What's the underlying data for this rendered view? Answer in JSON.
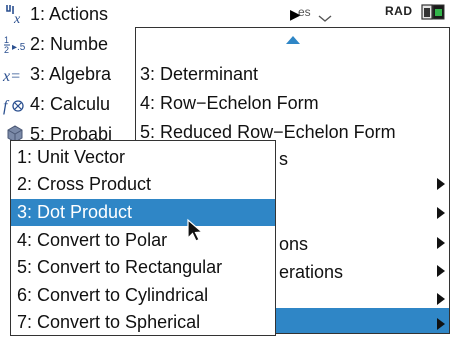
{
  "colors": {
    "accent": "#2f86c6",
    "border": "#333333",
    "icon": "#2a4f8f"
  },
  "top_menu": {
    "items": [
      {
        "icon": "actions-icon",
        "glyph": "x",
        "label": "1: Actions"
      },
      {
        "icon": "number-icon",
        "glyph": "½",
        "label": "2: Numbe"
      },
      {
        "icon": "algebra-icon",
        "glyph": "x=",
        "label": "3: Algebra"
      },
      {
        "icon": "calculus-icon",
        "glyph": "f∞",
        "label": "4: Calculu"
      },
      {
        "icon": "probability-icon",
        "glyph": "◆",
        "label": "5: Probabi"
      }
    ]
  },
  "status": {
    "mode_fragment": "es",
    "angle_mode": "RAD"
  },
  "matrix_menu": {
    "items": [
      {
        "label": "3: Determinant",
        "submenu": false
      },
      {
        "label": "4: Row−Echelon Form",
        "submenu": false
      },
      {
        "label": "5: Reduced Row−Echelon Form",
        "submenu": false
      },
      {
        "label": "s",
        "submenu": false
      },
      {
        "label": "",
        "submenu": true
      },
      {
        "label": "",
        "submenu": true
      },
      {
        "label": "ons",
        "submenu": true
      },
      {
        "label": "erations",
        "submenu": true
      },
      {
        "label": "",
        "submenu": true
      },
      {
        "label": "",
        "submenu": true
      }
    ]
  },
  "vector_menu": {
    "items": [
      {
        "label": "1: Unit Vector"
      },
      {
        "label": "2: Cross Product"
      },
      {
        "label": "3: Dot Product",
        "selected": true
      },
      {
        "label": "4: Convert to Polar"
      },
      {
        "label": "5: Convert to Rectangular"
      },
      {
        "label": "6: Convert to Cylindrical"
      },
      {
        "label": "7: Convert to Spherical"
      }
    ]
  }
}
